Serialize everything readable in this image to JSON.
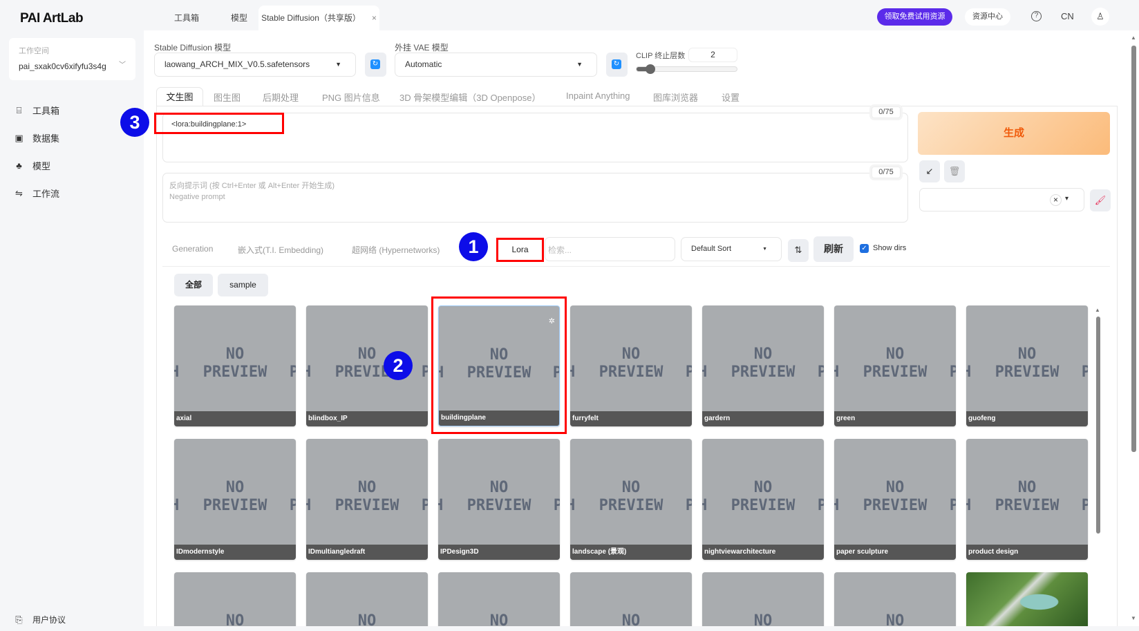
{
  "app": {
    "logo": "PAI ArtLab",
    "tabs": [
      "工具箱",
      "模型"
    ],
    "active_tab": "Stable Diffusion（共享版）",
    "close": "×"
  },
  "topbar": {
    "trial_button": "领取免费试用资源",
    "resource_center": "资源中心",
    "help": "?",
    "language": "CN",
    "avatar": "♙"
  },
  "sidebar": {
    "workspace_label": "工作空间",
    "workspace_value": "pai_sxak0cv6xifyfu3s4g",
    "items": [
      {
        "icon": "toolbox-icon",
        "glyph": "⌸",
        "label": "工具箱"
      },
      {
        "icon": "dataset-icon",
        "glyph": "▣",
        "label": "数据集"
      },
      {
        "icon": "model-icon",
        "glyph": "♣",
        "label": "模型"
      },
      {
        "icon": "workflow-icon",
        "glyph": "⇋",
        "label": "工作流"
      }
    ],
    "footer": "用户协议"
  },
  "settings": {
    "sd_model_label": "Stable Diffusion 模型",
    "sd_model_value": "laowang_ARCH_MIX_V0.5.safetensors",
    "vae_label": "外挂 VAE 模型",
    "vae_value": "Automatic",
    "clip_label": "CLIP 终止层数",
    "clip_value": "2",
    "clip_fraction": 0.1
  },
  "tabs": [
    "文生图",
    "图生图",
    "后期处理",
    "PNG 图片信息",
    "3D 骨架模型编辑（3D Openpose）",
    "Inpaint Anything",
    "图库浏览器",
    "设置"
  ],
  "prompt": {
    "value": "<lora:buildingplane:1>",
    "counter": "0/75",
    "neg_placeholder": "反向提示词 (按 Ctrl+Enter 或 Alt+Enter 开始生成)\nNegative prompt",
    "neg_counter": "0/75"
  },
  "actions": {
    "generate": "生成",
    "paste": "↙",
    "trash": "🗑",
    "clear": "×",
    "caret": "▾",
    "brush": "🖌"
  },
  "networks": {
    "tabs": [
      "Generation",
      "嵌入式(T.I. Embedding)",
      "超网络 (Hypernetworks)",
      "Lora"
    ],
    "search_placeholder": "检索...",
    "sort": "Default Sort",
    "sort_dir": "⇅",
    "refresh": "刷新",
    "show_dirs": "Show dirs",
    "show_dirs_checked": true,
    "filters": [
      "全部",
      "sample"
    ],
    "no_preview": [
      "NO",
      "PREVIEW"
    ],
    "cards": [
      "axial",
      "blindbox_IP",
      "buildingplane",
      "furryfelt",
      "gardern",
      "green",
      "guofeng",
      "IDmodernstyle",
      "IDmultiangledraft",
      "IPDesign3D",
      "landscape (景观)",
      "nightviewarchitecture",
      "paper sculpture",
      "product design",
      "",
      "",
      "",
      "",
      "",
      "",
      ""
    ]
  },
  "annotations": [
    "1",
    "2",
    "3"
  ]
}
